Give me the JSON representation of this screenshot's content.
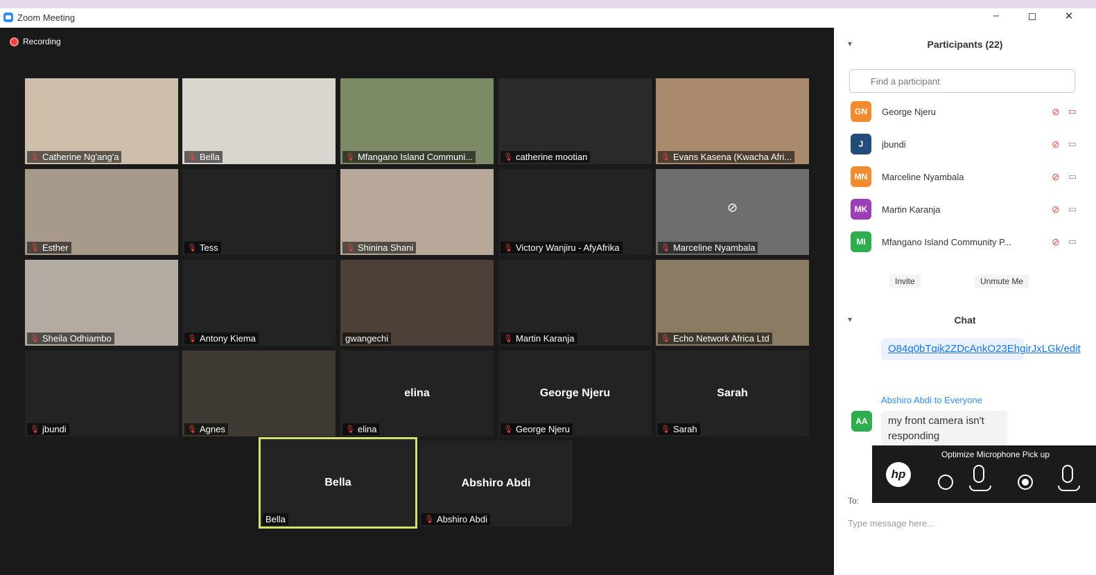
{
  "window": {
    "title": "Zoom Meeting",
    "minimize": "–",
    "restore": "◻",
    "close": "✕"
  },
  "meeting": {
    "recording_label": "Recording"
  },
  "tiles": [
    {
      "name": "Catherine Ng'ang'a",
      "muted": true,
      "center": "",
      "bg": "#cdbfaa"
    },
    {
      "name": "Bella",
      "muted": true,
      "center": "",
      "bg": "#d9d6d0"
    },
    {
      "name": "Mfangano Island Communi...",
      "muted": true,
      "center": "",
      "bg": "#7d8a66"
    },
    {
      "name": "catherine mootian",
      "muted": true,
      "center": "",
      "bg": "#2a2a2a"
    },
    {
      "name": "Evans Kasena (Kwacha Afri...",
      "muted": true,
      "center": "",
      "bg": "#a98a6c"
    },
    {
      "name": "Esther",
      "muted": true,
      "center": "",
      "bg": "#a79a8b"
    },
    {
      "name": "Tess",
      "muted": true,
      "center": "",
      "bg": "#232323"
    },
    {
      "name": "Shinina Shani",
      "muted": true,
      "center": "",
      "bg": "#b8a89a"
    },
    {
      "name": "Victory Wanjiru - AfyAfrika",
      "muted": true,
      "center": "",
      "bg": "#232323"
    },
    {
      "name": "Marceline Nyambala",
      "muted": true,
      "center": "",
      "bg": "#6e6e6e"
    },
    {
      "name": "Sheila Odhiambo",
      "muted": true,
      "center": "",
      "bg": "#b3aaa2"
    },
    {
      "name": "Antony Kiema",
      "muted": true,
      "center": "",
      "bg": "#232323"
    },
    {
      "name": "gwangechi",
      "muted": false,
      "center": "",
      "bg": "#4c4038"
    },
    {
      "name": "Martin Karanja",
      "muted": true,
      "center": "",
      "bg": "#232323"
    },
    {
      "name": "Echo Network Africa Ltd",
      "muted": true,
      "center": "",
      "bg": "#8a7c62"
    },
    {
      "name": "jbundi",
      "muted": true,
      "center": "",
      "bg": "#232323"
    },
    {
      "name": "Agnes",
      "muted": true,
      "center": "",
      "bg": "#3e3a33"
    },
    {
      "name": "elina",
      "muted": true,
      "center": "elina",
      "bg": "#232323"
    },
    {
      "name": "George Njeru",
      "muted": true,
      "center": "George Njeru",
      "bg": "#232323"
    },
    {
      "name": "Sarah",
      "muted": true,
      "center": "Sarah",
      "bg": "#232323"
    },
    {
      "name": "Bella",
      "muted": false,
      "center": "Bella",
      "bg": "#232323"
    },
    {
      "name": "Abshiro Abdi",
      "muted": true,
      "center": "Abshiro Abdi",
      "bg": "#232323"
    }
  ],
  "participants": {
    "title": "Participants (22)",
    "search_placeholder": "Find a participant",
    "list": [
      {
        "initials": "GN",
        "name": "George Njeru",
        "color": "#f28b30",
        "cam_off": true
      },
      {
        "initials": "J",
        "name": "jbundi",
        "color": "#234c7a",
        "cam_off": false
      },
      {
        "initials": "MN",
        "name": "Marceline Nyambala",
        "color": "#f28b30",
        "cam_off": false
      },
      {
        "initials": "MK",
        "name": "Martin Karanja",
        "color": "#9c3fb6",
        "cam_off": false
      },
      {
        "initials": "MI",
        "name": "Mfangano Island Community P...",
        "color": "#2fae4f",
        "cam_off": false
      }
    ],
    "invite_label": "Invite",
    "unmute_label": "Unmute Me"
  },
  "chat": {
    "title": "Chat",
    "link_text": "O84q0bTqik2ZDcAnkO23EhgirJxLGk/edit",
    "sender": "Abshiro Abdi",
    "sender_to": " to Everyone",
    "sender_initials": "AA",
    "message": "my front camera isn't responding",
    "to_label": "To:",
    "input_placeholder": "Type message here..."
  },
  "hp_overlay": {
    "title": "Optimize Microphone Pick up",
    "logo": "hp"
  }
}
